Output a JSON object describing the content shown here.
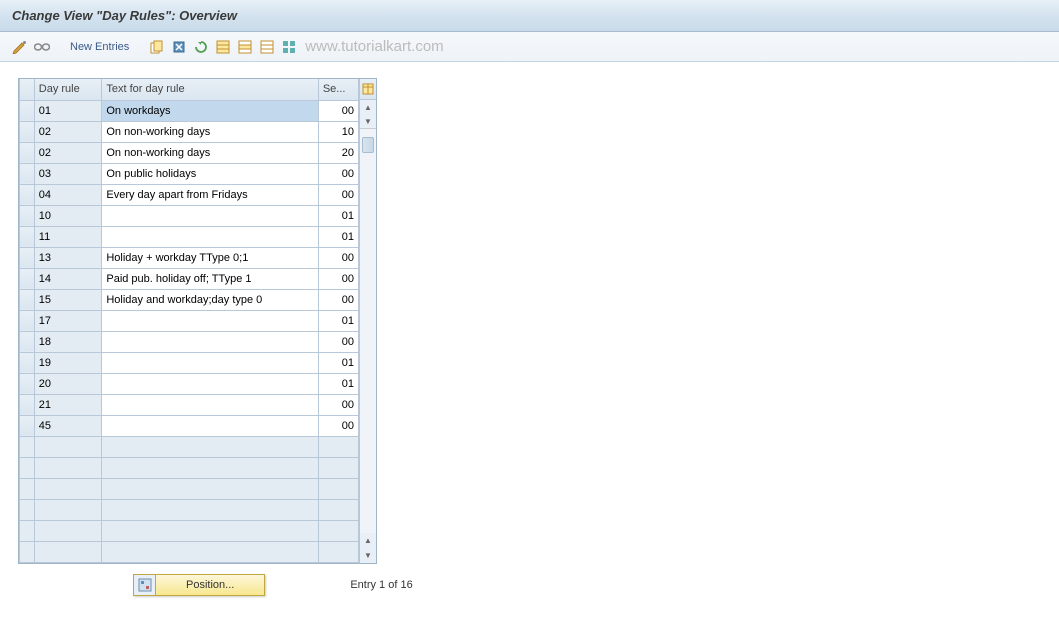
{
  "header": {
    "title": "Change View \"Day Rules\": Overview"
  },
  "toolbar": {
    "new_entries_label": "New Entries",
    "watermark": "www.tutorialkart.com"
  },
  "table": {
    "columns": {
      "rule": "Day rule",
      "text": "Text for day rule",
      "seq": "Se..."
    },
    "rows": [
      {
        "rule": "01",
        "text": "On workdays",
        "seq": "00",
        "selected": true
      },
      {
        "rule": "02",
        "text": "On non-working days",
        "seq": "10"
      },
      {
        "rule": "02",
        "text": "On non-working days",
        "seq": "20"
      },
      {
        "rule": "03",
        "text": "On public holidays",
        "seq": "00"
      },
      {
        "rule": "04",
        "text": "Every day apart from Fridays",
        "seq": "00"
      },
      {
        "rule": "10",
        "text": "",
        "seq": "01"
      },
      {
        "rule": "11",
        "text": "",
        "seq": "01"
      },
      {
        "rule": "13",
        "text": "Holiday + workday TType 0;1",
        "seq": "00"
      },
      {
        "rule": "14",
        "text": "Paid pub. holiday off; TType 1",
        "seq": "00"
      },
      {
        "rule": "15",
        "text": "Holiday and workday;day type 0",
        "seq": "00"
      },
      {
        "rule": "17",
        "text": "",
        "seq": "01"
      },
      {
        "rule": "18",
        "text": "",
        "seq": "00"
      },
      {
        "rule": "19",
        "text": "",
        "seq": "01"
      },
      {
        "rule": "20",
        "text": "",
        "seq": "01"
      },
      {
        "rule": "21",
        "text": "",
        "seq": "00"
      },
      {
        "rule": "45",
        "text": "",
        "seq": "00"
      }
    ],
    "empty_rows": 6
  },
  "footer": {
    "position_label": "Position...",
    "entry_status": "Entry 1 of 16"
  }
}
